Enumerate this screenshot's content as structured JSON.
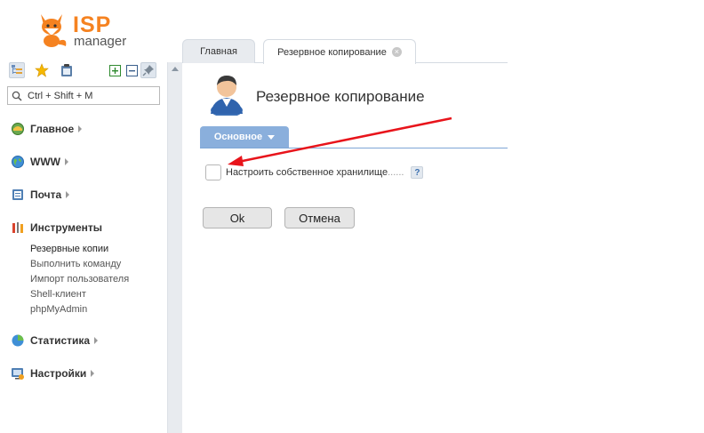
{
  "logo": {
    "brand": "ISP",
    "product": "manager"
  },
  "sidebar": {
    "toolbar": [
      {
        "icon": "tree-view-icon",
        "active": true
      },
      {
        "icon": "star-icon"
      },
      {
        "icon": "clipboard-icon"
      },
      {
        "icon": "expand-all-icon"
      },
      {
        "icon": "collapse-all-icon"
      },
      {
        "icon": "pin-icon"
      }
    ],
    "search": {
      "placeholder": "Ctrl + Shift + M"
    },
    "sections": [
      {
        "label": "Главное",
        "icon": "home-icon"
      },
      {
        "label": "WWW",
        "icon": "globe-icon"
      },
      {
        "label": "Почта",
        "icon": "mail-icon"
      },
      {
        "label": "Инструменты",
        "icon": "tools-icon",
        "items": [
          "Резервные копии",
          "Выполнить команду",
          "Импорт пользователя",
          "Shell-клиент",
          "phpMyAdmin"
        ]
      },
      {
        "label": "Статистика",
        "icon": "stats-icon"
      },
      {
        "label": "Настройки",
        "icon": "settings-icon"
      }
    ]
  },
  "tabs": [
    {
      "label": "Главная"
    },
    {
      "label": "Резервное копирование",
      "active": true
    }
  ],
  "page": {
    "title": "Резервное копирование",
    "subtab": "Основное",
    "field_label": "Настроить собственное хранилище",
    "field_dots": "......",
    "help": "?",
    "ok": "Ok",
    "cancel": "Отмена"
  },
  "colors": {
    "accent": "#8aafdc",
    "brand": "#f58220",
    "annotation": "#e8141b"
  }
}
